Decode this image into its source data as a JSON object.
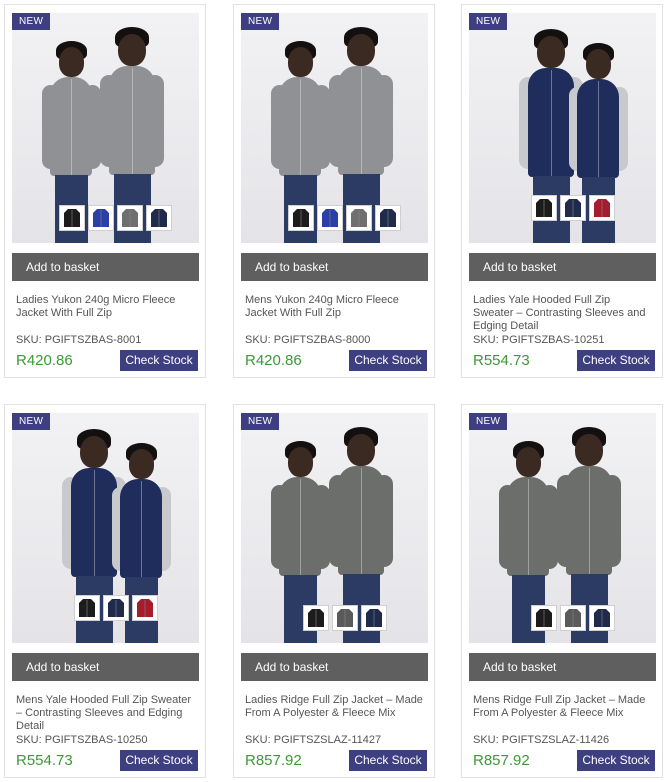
{
  "products": [
    {
      "badge": "NEW",
      "basket_label": "Add to basket",
      "title": "Ladies Yukon 240g Micro Fleece Jacket With Full Zip",
      "sku": "SKU: PGIFTSZBAS-8001",
      "price": "R420.86",
      "stock_label": "Check Stock",
      "style": "fleece",
      "swatches": [
        "#1c1c1c",
        "#2b3fa8",
        "#6f6f6f",
        "#1f2a4d"
      ]
    },
    {
      "badge": "NEW",
      "basket_label": "Add to basket",
      "title": "Mens Yukon 240g Micro Fleece Jacket With Full Zip",
      "sku": "SKU: PGIFTSZBAS-8000",
      "price": "R420.86",
      "stock_label": "Check Stock",
      "style": "fleece",
      "swatches": [
        "#1c1c1c",
        "#2b3fa8",
        "#6f6f6f",
        "#1f2a4d"
      ]
    },
    {
      "badge": "NEW",
      "basket_label": "Add to basket",
      "title": "Ladies Yale Hooded Full Zip Sweater – Contrasting Sleeves and Edging Detail",
      "sku": "SKU: PGIFTSZBAS-10251",
      "price": "R554.73",
      "stock_label": "Check Stock",
      "style": "hoodie",
      "swatches": [
        "#1c1c1c",
        "#1f2a4d",
        "#a51d2d"
      ]
    },
    {
      "badge": "NEW",
      "basket_label": "Add to basket",
      "title": "Mens Yale Hooded Full Zip Sweater – Contrasting Sleeves and Edging Detail",
      "sku": "SKU: PGIFTSZBAS-10250",
      "price": "R554.73",
      "stock_label": "Check Stock",
      "style": "hoodie",
      "swatches": [
        "#1c1c1c",
        "#1f2a4d",
        "#a51d2d"
      ]
    },
    {
      "badge": "NEW",
      "basket_label": "Add to basket",
      "title": "Ladies Ridge Full Zip Jacket – Made From A Polyester & Fleece Mix",
      "sku": "SKU: PGIFTSZSLAZ-11427",
      "price": "R857.92",
      "stock_label": "Check Stock",
      "style": "ridge",
      "swatches": [
        "#1c1c1c",
        "#5a5a5a",
        "#1f2a4d"
      ]
    },
    {
      "badge": "NEW",
      "basket_label": "Add to basket",
      "title": "Mens Ridge Full Zip Jacket – Made From A Polyester & Fleece Mix",
      "sku": "SKU: PGIFTSZSLAZ-11426",
      "price": "R857.92",
      "stock_label": "Check Stock",
      "style": "ridge",
      "swatches": [
        "#1c1c1c",
        "#5a5a5a",
        "#1f2a4d"
      ]
    }
  ],
  "colors": {
    "badge": "#3d3f80",
    "button": "#3d3f80",
    "basket": "#5f5f5f",
    "price": "#3a9a34"
  }
}
